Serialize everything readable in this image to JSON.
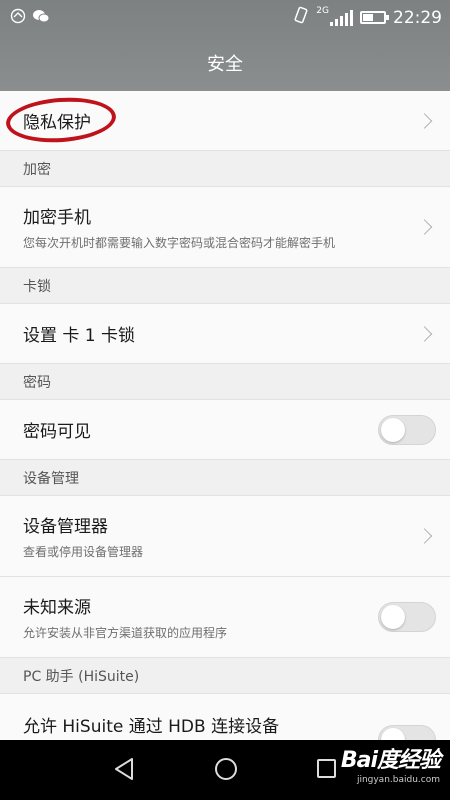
{
  "status": {
    "network": "2G",
    "time": "22:29"
  },
  "header": {
    "title": "安全"
  },
  "items": {
    "privacy": {
      "title": "隐私保护"
    },
    "encrypt_section": "加密",
    "encrypt_phone": {
      "title": "加密手机",
      "subtitle": "您每次开机时都需要输入数字密码或混合密码才能解密手机"
    },
    "simlock_section": "卡锁",
    "simlock": {
      "title": "设置 卡 1 卡锁"
    },
    "password_section": "密码",
    "password_visible": {
      "title": "密码可见",
      "enabled": false
    },
    "device_section": "设备管理",
    "device_admin": {
      "title": "设备管理器",
      "subtitle": "查看或停用设备管理器"
    },
    "unknown_sources": {
      "title": "未知来源",
      "subtitle": "允许安装从非官方渠道获取的应用程序",
      "enabled": false
    },
    "pc_section": "PC 助手 (HiSuite)",
    "hisuite_hdb": {
      "title": "允许 HiSuite 通过 HDB 连接设备"
    }
  },
  "watermark": {
    "logo": "Bai度经验",
    "url": "jingyan.baidu.com"
  },
  "colors": {
    "header": "#828686",
    "highlight_ring": "#c0121a",
    "background": "#f2f2f2"
  },
  "icons": [
    "notification-icon",
    "wechat-icon",
    "vibrate-icon",
    "signal-icon",
    "battery-icon",
    "back-icon",
    "home-icon",
    "recent-apps-icon",
    "chevron-right-icon"
  ]
}
